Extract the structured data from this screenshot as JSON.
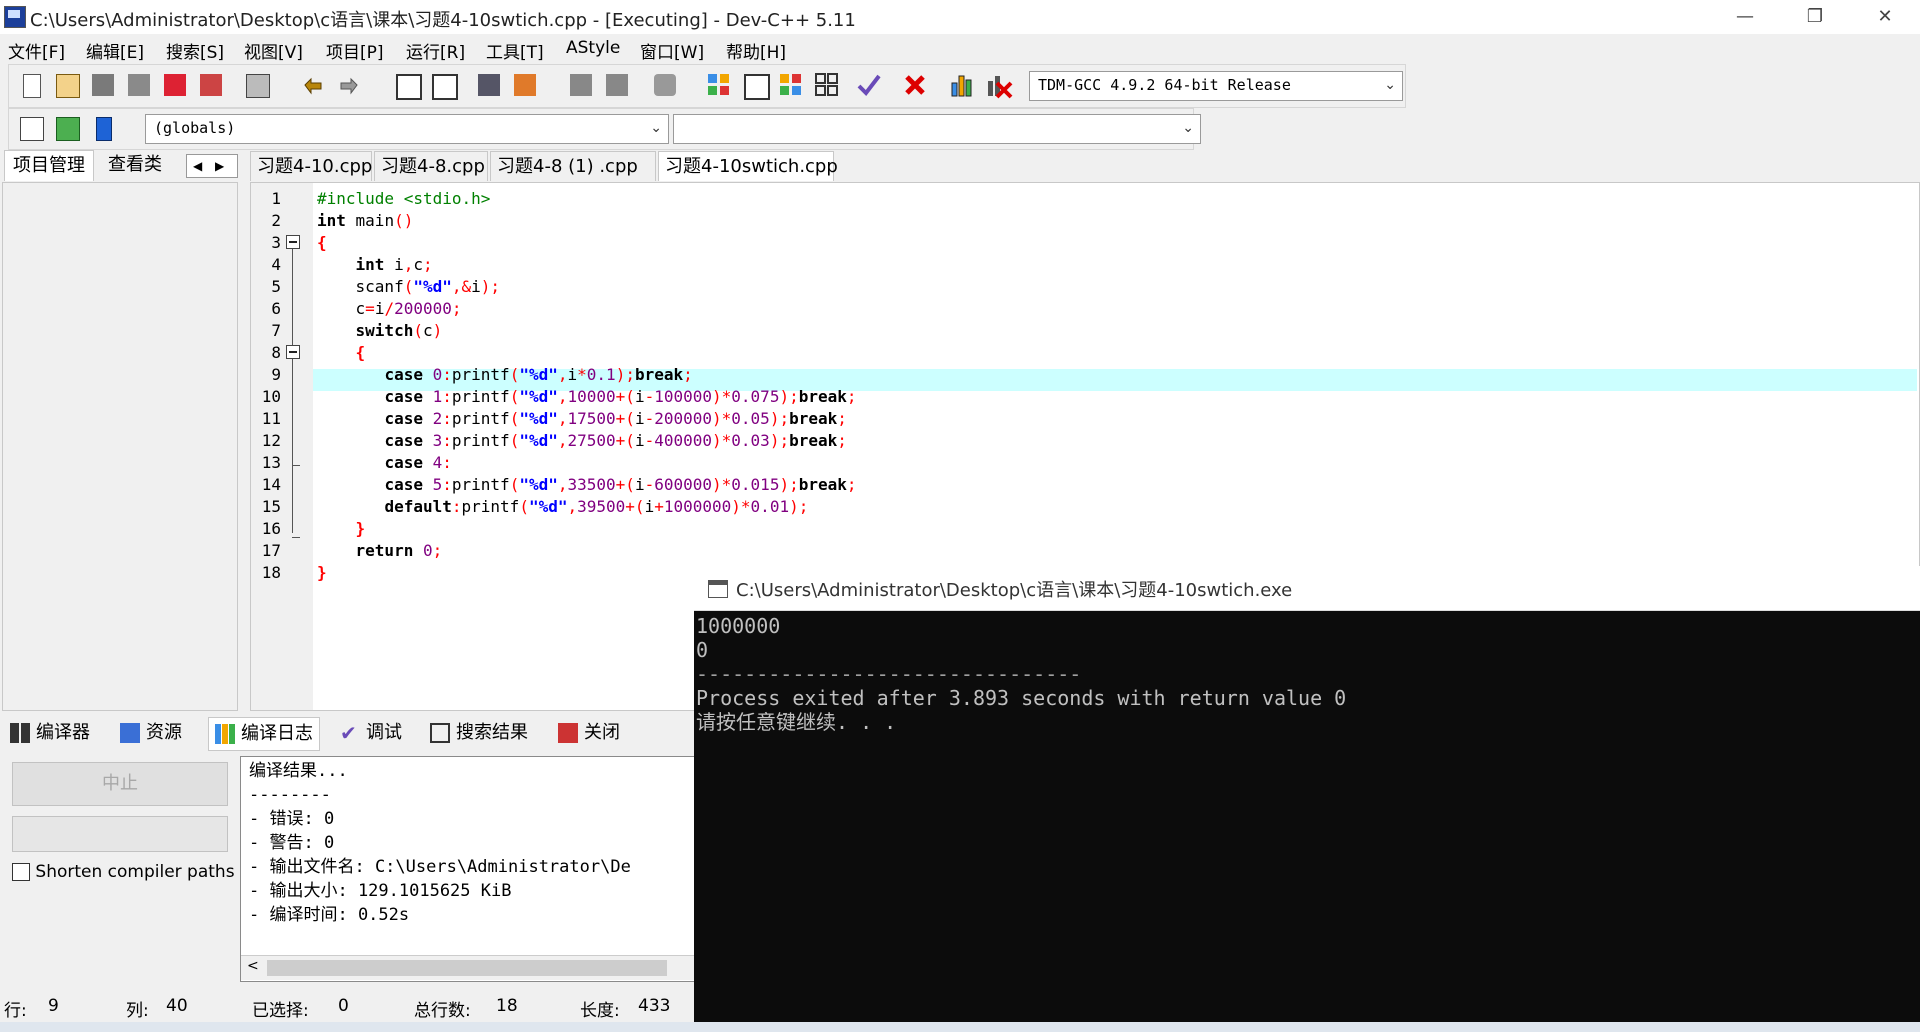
{
  "window": {
    "title": "C:\\Users\\Administrator\\Desktop\\c语言\\课本\\习题4-10swtich.cpp - [Executing] - Dev-C++ 5.11",
    "minimize": "—",
    "maximize": "❐",
    "close": "✕"
  },
  "menu": [
    "文件[F]",
    "编辑[E]",
    "搜索[S]",
    "视图[V]",
    "项目[P]",
    "运行[R]",
    "工具[T]",
    "AStyle",
    "窗口[W]",
    "帮助[H]"
  ],
  "toolbar": {
    "compiler_select": "TDM-GCC 4.9.2 64-bit Release",
    "scope_select": "(globals)",
    "symbol_select": ""
  },
  "left_tabs": [
    "项目管理",
    "查看类"
  ],
  "file_tabs": [
    "习题4-10.cpp",
    "习题4-8.cpp",
    "习题4-8 (1) .cpp",
    "习题4-10swtich.cpp"
  ],
  "line_numbers": [
    "1",
    "2",
    "3",
    "4",
    "5",
    "6",
    "7",
    "8",
    "9",
    "10",
    "11",
    "12",
    "13",
    "14",
    "15",
    "16",
    "17",
    "18"
  ],
  "bottom_tabs": [
    "编译器",
    "资源",
    "编译日志",
    "调试",
    "搜索结果",
    "关闭"
  ],
  "bottom_left": {
    "abort_button": "中止",
    "shorten_checkbox": "Shorten compiler paths"
  },
  "compile_log": [
    "编译结果...",
    "--------",
    "- 错误: 0",
    "- 警告: 0",
    "- 输出文件名: C:\\Users\\Administrator\\De",
    "- 输出大小: 129.1015625 KiB",
    "- 编译时间: 0.52s"
  ],
  "status": {
    "row_label": "行:",
    "row": "9",
    "col_label": "列:",
    "col": "40",
    "sel_label": "已选择:",
    "sel": "0",
    "lines_label": "总行数:",
    "lines": "18",
    "len_label": "长度:",
    "len": "433"
  },
  "console": {
    "title": "C:\\Users\\Administrator\\Desktop\\c语言\\课本\\习题4-10swtich.exe",
    "lines": [
      "1000000",
      "0",
      "--------------------------------",
      "Process exited after 3.893 seconds with return value 0",
      "请按任意键继续. . ."
    ]
  },
  "colors": {
    "highlight_line": "#ccffff",
    "keyword": "#000000",
    "string": "#0000ff",
    "number": "#800080",
    "symbol": "#ff0000",
    "preprocessor": "#008000"
  }
}
